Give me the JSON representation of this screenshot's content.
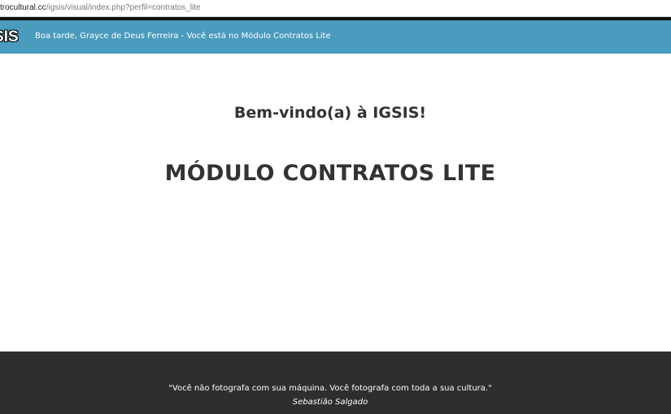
{
  "browser": {
    "url_domain": "trocultural.cc",
    "url_path": "/igsis/visual/index.php?perfil=contratos_lite"
  },
  "navbar": {
    "brand": "SIS",
    "greeting": "Boa tarde, Grayce de Deus Ferreira - Você está no Módulo Contratos Lite",
    "background_color": "#4a9bbd"
  },
  "main": {
    "welcome": "Bem-vindo(a) à IGSIS!",
    "module_title": "MÓDULO CONTRATOS LITE"
  },
  "footer": {
    "quote": "\"Você não fotografa com sua máquina. Você fotografa com toda a sua cultura.\"",
    "author": "Sebastião Salgado",
    "background_color": "#2e2e2e"
  }
}
